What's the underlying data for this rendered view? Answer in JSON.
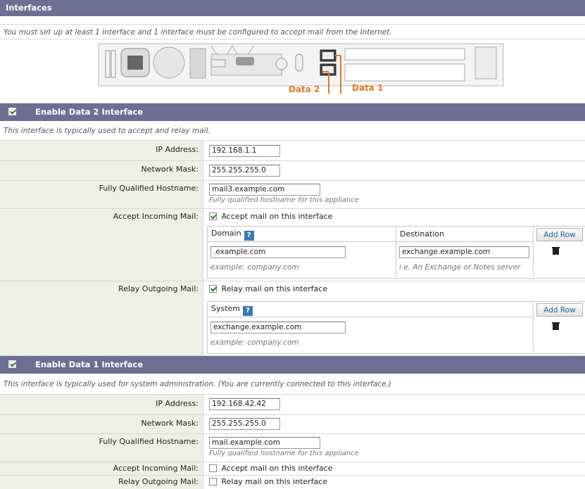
{
  "header": {
    "title": "Interfaces"
  },
  "intro_note": "You must set up at least 1 interface and 1 interface must be configured to accept mail from the Internet.",
  "diagram": {
    "data2_label": "Data 2",
    "data1_label": "Data 1",
    "accent_color": "#e07a1f"
  },
  "data2": {
    "checked": true,
    "title": "Enable Data 2 Interface",
    "note": "This interface is typically used to accept and relay mail.",
    "ip_label": "IP Address:",
    "ip_value": "192.168.1.1",
    "mask_label": "Network Mask:",
    "mask_value": "255.255.255.0",
    "fqdn_label": "Fully Qualified Hostname:",
    "fqdn_value": "mail3.example.com",
    "fqdn_hint": "Fully qualified hostname for this appliance",
    "accept_label": "Accept Incoming Mail:",
    "accept_checkbox_label": "Accept mail on this interface",
    "accept_checked": true,
    "domain_header": "Domain",
    "destination_header": "Destination",
    "add_row_label": "Add Row",
    "domain_value": ".example.com",
    "destination_value": "exchange.example.com",
    "domain_hint": "example: company.com",
    "destination_hint": "i.e. An Exchange or Notes server",
    "relay_label": "Relay Outgoing Mail:",
    "relay_checkbox_label": "Relay mail on this interface",
    "relay_checked": true,
    "system_header": "System",
    "system_value": "exchange.example.com",
    "system_hint": "example: company.com"
  },
  "data1": {
    "checked": true,
    "title": "Enable Data 1 Interface",
    "note": "This interface is typically used for system administration.  (You are currently connected to this interface.)",
    "ip_label": "IP Address:",
    "ip_value": "192.168.42.42",
    "mask_label": "Network Mask:",
    "mask_value": "255.255.255.0",
    "fqdn_label": "Fully Qualified Hostname:",
    "fqdn_value": "mail.example.com",
    "fqdn_hint": "Fully qualified hostname for this appliance",
    "accept_label": "Accept Incoming Mail:",
    "accept_checkbox_label": "Accept mail on this interface",
    "accept_checked": false,
    "relay_label": "Relay Outgoing Mail:",
    "relay_checkbox_label": "Relay mail on this interface",
    "relay_checked": false
  }
}
